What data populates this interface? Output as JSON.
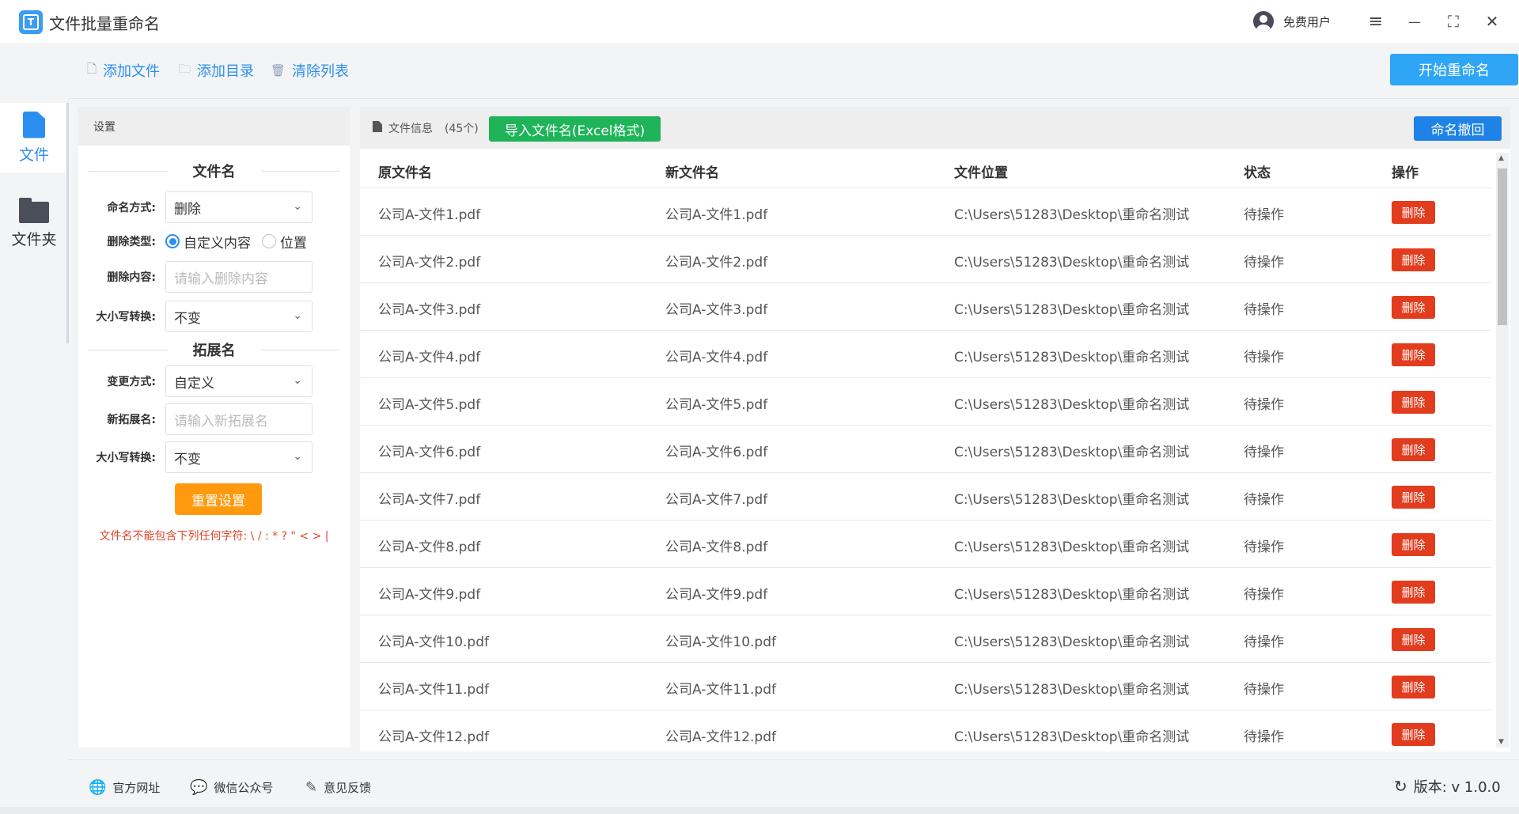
{
  "app": {
    "title": "文件批量重命名",
    "logo_letter": "T",
    "user": "免费用户"
  },
  "window_controls": {
    "menu": "≡",
    "minimize": "—",
    "maximize": "⛶",
    "close": "✕"
  },
  "nav": [
    {
      "label": "文件",
      "icon": "file-icon",
      "active": true
    },
    {
      "label": "文件夹",
      "icon": "folder-icon",
      "active": false
    }
  ],
  "toolbar": {
    "add_file": "添加文件",
    "add_dir": "添加目录",
    "clear_list": "清除列表",
    "start": "开始重命名"
  },
  "settings": {
    "header": "设置",
    "filename_section": "文件名",
    "naming_mode_label": "命名方式:",
    "naming_mode_value": "删除",
    "delete_type_label": "删除类型:",
    "delete_type_options": [
      "自定义内容",
      "位置"
    ],
    "delete_type_selected": "自定义内容",
    "delete_content_label": "删除内容:",
    "delete_content_placeholder": "请输入删除内容",
    "case_label": "大小写转换:",
    "case_value": "不变",
    "ext_section": "拓展名",
    "ext_mode_label": "变更方式:",
    "ext_mode_value": "自定义",
    "new_ext_label": "新拓展名:",
    "new_ext_placeholder": "请输入新拓展名",
    "ext_case_label": "大小写转换:",
    "ext_case_value": "不变",
    "reset": "重置设置",
    "warning": "文件名不能包含下列任何字符: \\ / : * ? \" < > |"
  },
  "files": {
    "header_title": "文件信息",
    "count": "(45个)",
    "import": "导入文件名(Excel格式)",
    "undo": "命名撤回",
    "columns": [
      "原文件名",
      "新文件名",
      "文件位置",
      "状态",
      "操作"
    ],
    "rows": [
      {
        "orig": "公司A-文件1.pdf",
        "new": "公司A-文件1.pdf",
        "path": "C:\\Users\\51283\\Desktop\\重命名测试",
        "status": "待操作",
        "action": "删除"
      },
      {
        "orig": "公司A-文件2.pdf",
        "new": "公司A-文件2.pdf",
        "path": "C:\\Users\\51283\\Desktop\\重命名测试",
        "status": "待操作",
        "action": "删除"
      },
      {
        "orig": "公司A-文件3.pdf",
        "new": "公司A-文件3.pdf",
        "path": "C:\\Users\\51283\\Desktop\\重命名测试",
        "status": "待操作",
        "action": "删除"
      },
      {
        "orig": "公司A-文件4.pdf",
        "new": "公司A-文件4.pdf",
        "path": "C:\\Users\\51283\\Desktop\\重命名测试",
        "status": "待操作",
        "action": "删除"
      },
      {
        "orig": "公司A-文件5.pdf",
        "new": "公司A-文件5.pdf",
        "path": "C:\\Users\\51283\\Desktop\\重命名测试",
        "status": "待操作",
        "action": "删除"
      },
      {
        "orig": "公司A-文件6.pdf",
        "new": "公司A-文件6.pdf",
        "path": "C:\\Users\\51283\\Desktop\\重命名测试",
        "status": "待操作",
        "action": "删除"
      },
      {
        "orig": "公司A-文件7.pdf",
        "new": "公司A-文件7.pdf",
        "path": "C:\\Users\\51283\\Desktop\\重命名测试",
        "status": "待操作",
        "action": "删除"
      },
      {
        "orig": "公司A-文件8.pdf",
        "new": "公司A-文件8.pdf",
        "path": "C:\\Users\\51283\\Desktop\\重命名测试",
        "status": "待操作",
        "action": "删除"
      },
      {
        "orig": "公司A-文件9.pdf",
        "new": "公司A-文件9.pdf",
        "path": "C:\\Users\\51283\\Desktop\\重命名测试",
        "status": "待操作",
        "action": "删除"
      },
      {
        "orig": "公司A-文件10.pdf",
        "new": "公司A-文件10.pdf",
        "path": "C:\\Users\\51283\\Desktop\\重命名测试",
        "status": "待操作",
        "action": "删除"
      },
      {
        "orig": "公司A-文件11.pdf",
        "new": "公司A-文件11.pdf",
        "path": "C:\\Users\\51283\\Desktop\\重命名测试",
        "status": "待操作",
        "action": "删除"
      },
      {
        "orig": "公司A-文件12.pdf",
        "new": "公司A-文件12.pdf",
        "path": "C:\\Users\\51283\\Desktop\\重命名测试",
        "status": "待操作",
        "action": "删除"
      }
    ]
  },
  "footer": {
    "website": "官方网址",
    "wechat": "微信公众号",
    "feedback": "意见反馈",
    "version": "版本: v 1.0.0"
  },
  "colors": {
    "primary": "#2b8ff0",
    "start_button": "#2ea6f5",
    "import_button": "#1fb35a",
    "undo_button": "#1e82e6",
    "delete_button": "#e23c1e",
    "reset_button": "#ff9a0e",
    "warning_text": "#e2452b"
  }
}
